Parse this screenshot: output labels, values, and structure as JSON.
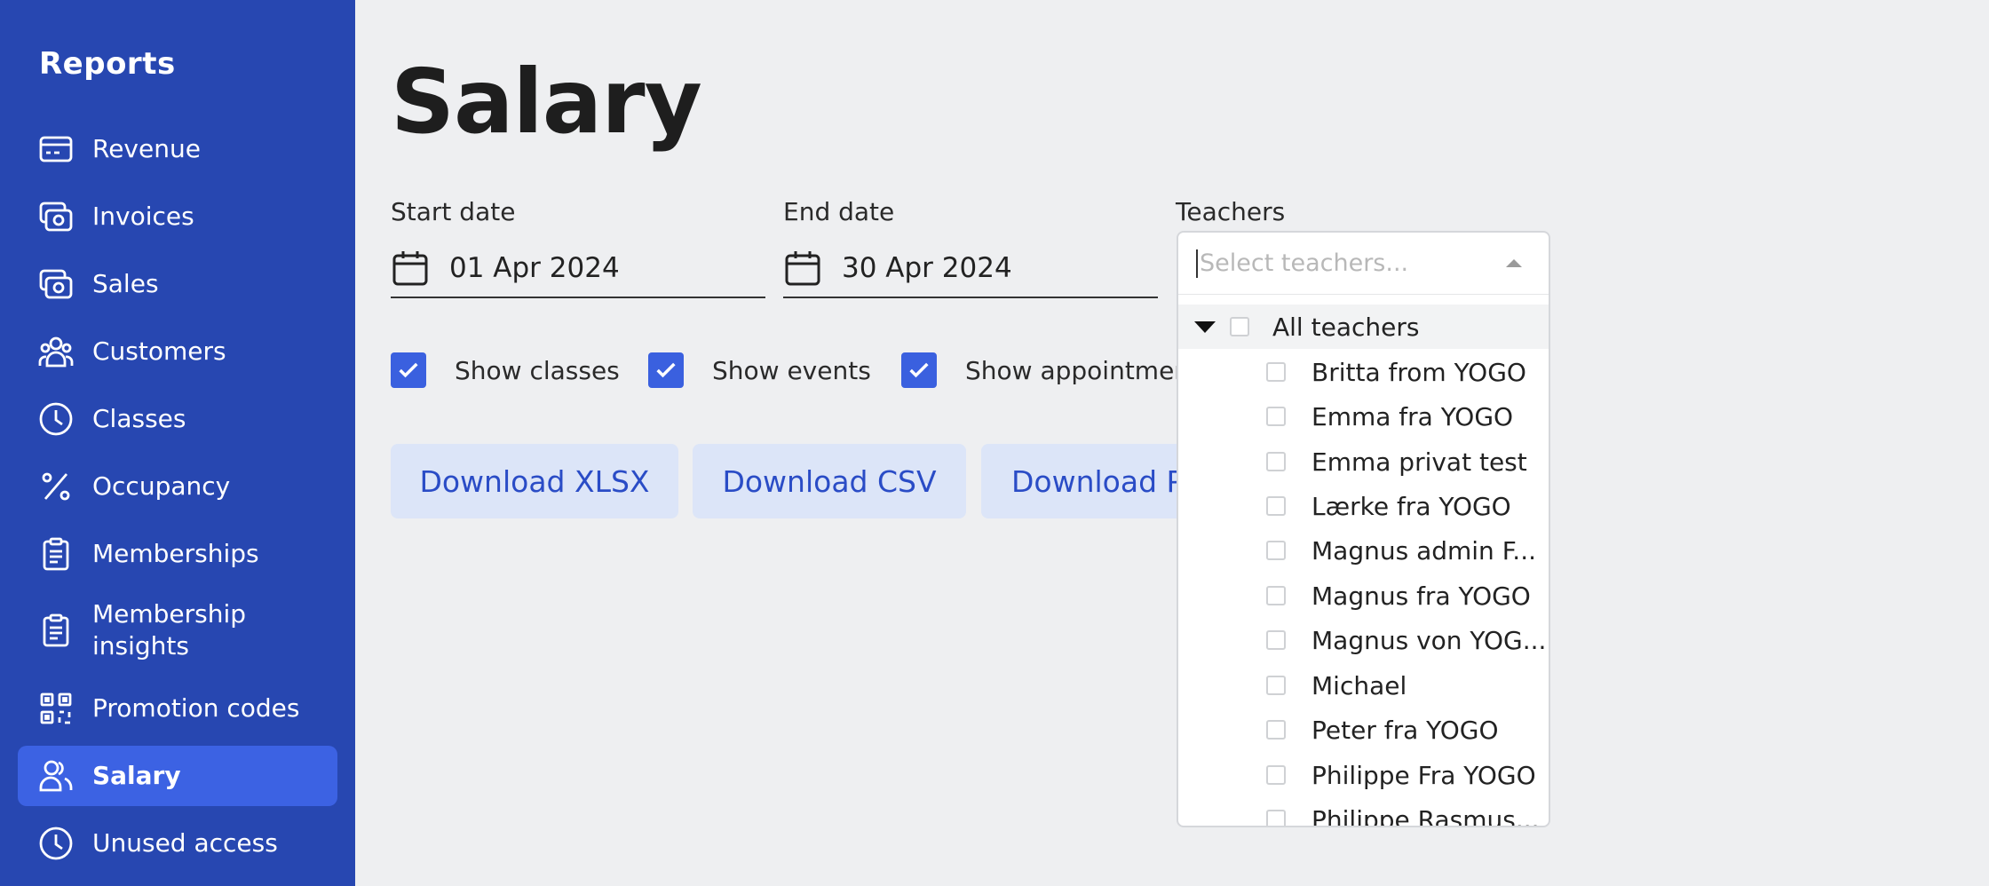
{
  "sidebar": {
    "title": "Reports",
    "items": [
      {
        "label": "Revenue",
        "icon": "card-icon"
      },
      {
        "label": "Invoices",
        "icon": "money-icon"
      },
      {
        "label": "Sales",
        "icon": "money-icon"
      },
      {
        "label": "Customers",
        "icon": "users-icon"
      },
      {
        "label": "Classes",
        "icon": "clock-icon"
      },
      {
        "label": "Occupancy",
        "icon": "percent-icon"
      },
      {
        "label": "Memberships",
        "icon": "clipboard-icon"
      },
      {
        "label": "Membership insights",
        "icon": "clipboard-icon"
      },
      {
        "label": "Promotion codes",
        "icon": "qr-code-icon"
      },
      {
        "label": "Salary",
        "icon": "users-icon",
        "active": true
      },
      {
        "label": "Unused access",
        "icon": "clock-icon"
      }
    ]
  },
  "main": {
    "title": "Salary",
    "start_date": {
      "label": "Start date",
      "value": "01 Apr 2024"
    },
    "end_date": {
      "label": "End date",
      "value": "30 Apr 2024"
    },
    "teachers": {
      "label": "Teachers",
      "placeholder": "Select teachers..."
    },
    "checks": [
      {
        "label": "Show classes",
        "checked": true
      },
      {
        "label": "Show events",
        "checked": true
      },
      {
        "label": "Show appointments",
        "checked": true
      }
    ],
    "buttons": {
      "xlsx": "Download XLSX",
      "csv": "Download CSV",
      "pdf": "Download PDF"
    }
  },
  "teacher_tree": {
    "root": "All teachers",
    "items": [
      "Britta from YOGO",
      "Emma fra YOGO",
      "Emma privat test",
      "Lærke fra YOGO",
      "Magnus admin F...",
      "Magnus fra YOGO",
      "Magnus von YOG...",
      "Michael",
      "Peter fra YOGO",
      "Philippe Fra YOGO",
      "Philippe Rasmus..."
    ]
  },
  "colors": {
    "sidebar": "#2747b1",
    "active": "#3c62e3",
    "accent": "#3a60df",
    "button_bg": "#dce5f8",
    "button_text": "#2a4cc6"
  }
}
